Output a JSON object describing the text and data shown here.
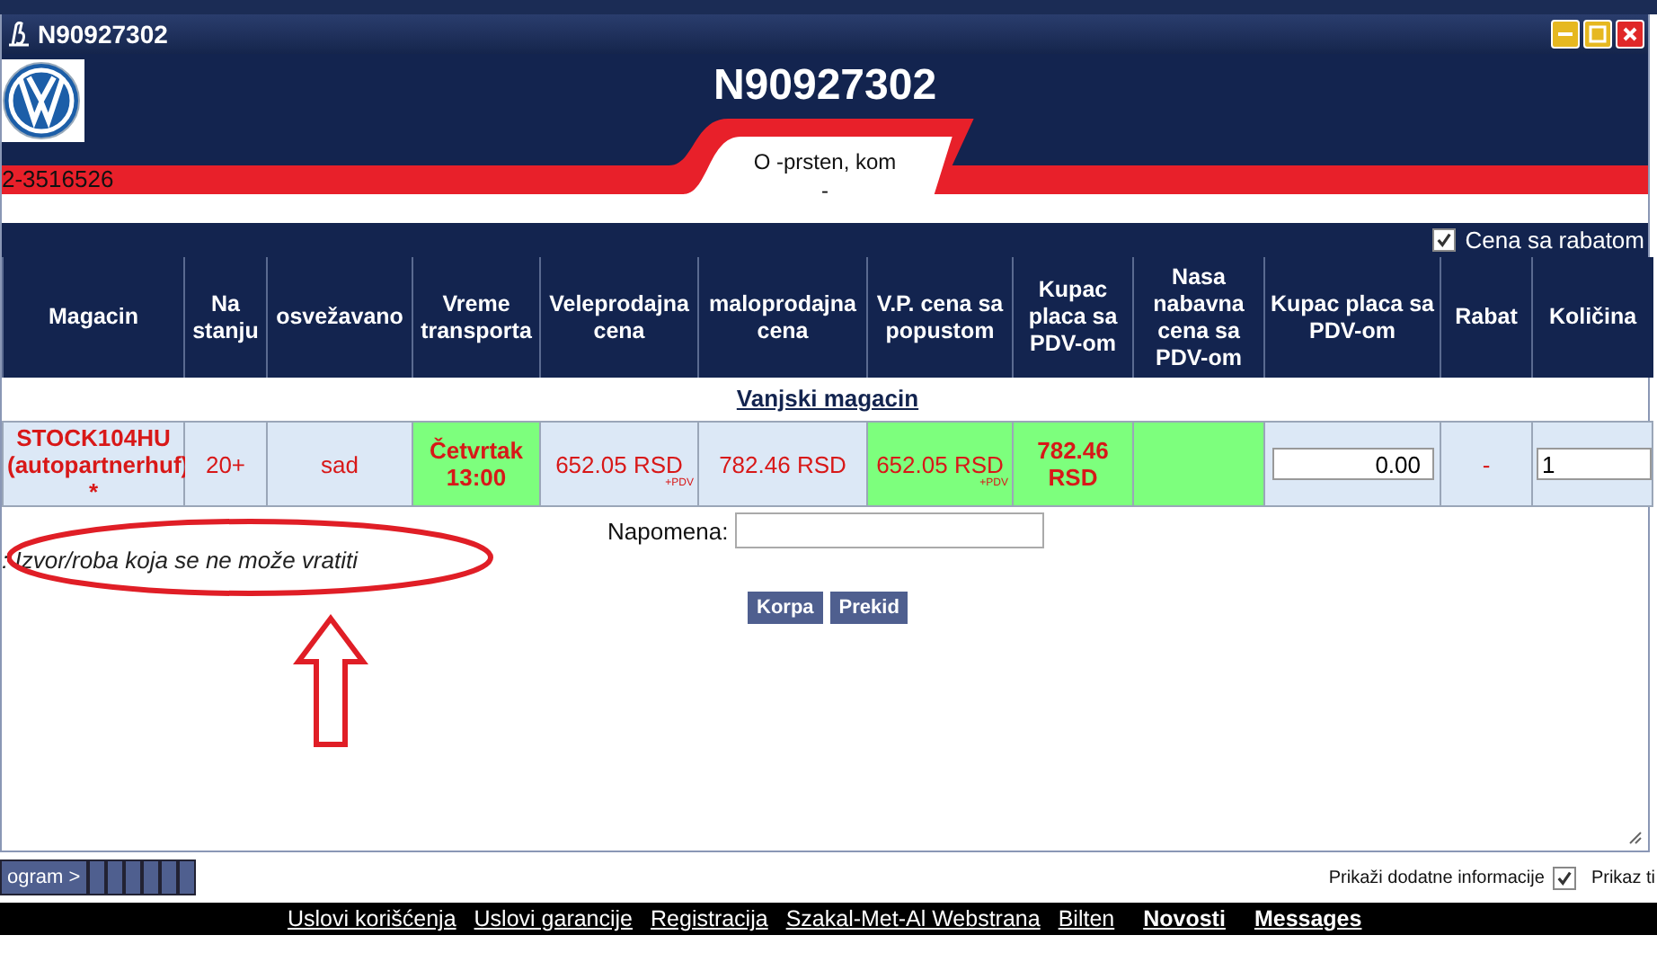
{
  "window": {
    "title": "N90927302",
    "buttons": [
      {
        "kind": "minimize"
      },
      {
        "kind": "maximize"
      },
      {
        "kind": "close"
      }
    ]
  },
  "header": {
    "title": "N90927302",
    "code": "2-3516526",
    "tab_name": "O -prsten, kom",
    "tab_sub": "-"
  },
  "options": {
    "label": "Cena sa rabatom",
    "checked": true
  },
  "table": {
    "columns": [
      "Magacin",
      "Na stanju",
      "osvežavano",
      "Vreme transporta",
      "Veleprodajna cena",
      "maloprodajna cena",
      "V.P. cena sa popustom",
      "Kupac placa sa PDV-om",
      "Nasa nabavna cena sa PDV-om",
      "Kupac placa sa PDV-om",
      "Rabat",
      "Količina"
    ],
    "group_label": "Vanjski magacin",
    "rows": [
      {
        "cells": [
          {
            "kind": "text",
            "text": "STOCK104HU (autopartnerhuf) *",
            "bold": true,
            "highlight": false
          },
          {
            "kind": "text",
            "text": "20+",
            "bold": false,
            "highlight": false
          },
          {
            "kind": "text",
            "text": "sad",
            "bold": false,
            "highlight": false
          },
          {
            "kind": "text",
            "text": "Četvrtak 13:00",
            "bold": true,
            "highlight": true
          },
          {
            "kind": "price",
            "text": "652.05 RSD",
            "note": "+PDV",
            "bold": false,
            "highlight": false
          },
          {
            "kind": "text",
            "text": "782.46 RSD",
            "bold": false,
            "highlight": false
          },
          {
            "kind": "price",
            "text": "652.05 RSD",
            "note": "+PDV",
            "bold": false,
            "highlight": true
          },
          {
            "kind": "price",
            "text": "782.46 RSD",
            "bold": true,
            "highlight": true
          },
          {
            "kind": "text",
            "bold": false,
            "highlight": true
          },
          {
            "kind": "amount_input",
            "value": "0.00",
            "highlight": false
          },
          {
            "kind": "text",
            "text": "-",
            "bold": false,
            "highlight": false
          },
          {
            "kind": "quantity_input",
            "value": "1",
            "highlight": false
          }
        ]
      }
    ]
  },
  "note_label": "Napomena:",
  "legend": ": Izvor/roba koja se ne može vratiti",
  "actions": [
    "Korpa",
    "Prekid"
  ],
  "status_bar": {
    "program_button": "ogram >",
    "info_label": "Prikaži dodatne informacije",
    "info_checked": true,
    "cut_label": "Prikaz ti"
  },
  "footer_links": [
    {
      "text": "Uslovi korišćenja",
      "bold": false
    },
    {
      "text": "Uslovi garancije",
      "bold": false
    },
    {
      "text": "Registracija",
      "bold": false
    },
    {
      "text": "Szakal-Met-Al Webstrana",
      "bold": false
    },
    {
      "text": "Bilten",
      "bold": false
    },
    {
      "text": "Novosti",
      "bold": true
    },
    {
      "text": "Messages",
      "bold": true
    }
  ]
}
